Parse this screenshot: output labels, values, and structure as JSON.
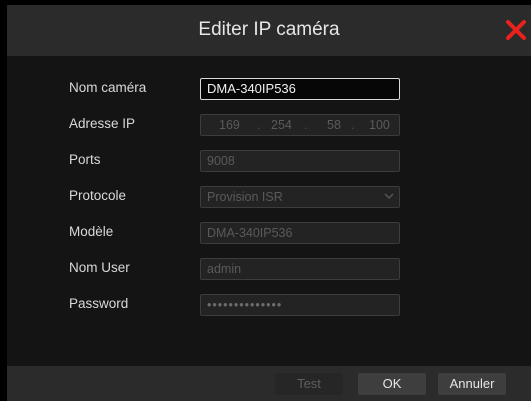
{
  "dialog": {
    "title": "Editer IP caméra",
    "close_icon": "close-icon",
    "accent_close": "#e8231c"
  },
  "form": {
    "camera_name": {
      "label": "Nom caméra",
      "value": "DMA-340IP536"
    },
    "ip_address": {
      "label": "Adresse IP",
      "octets": [
        "169",
        "254",
        "58",
        "100"
      ],
      "separator": "."
    },
    "ports": {
      "label": "Ports",
      "value": "9008"
    },
    "protocol": {
      "label": "Protocole",
      "value": "Provision ISR",
      "icon": "chevron-down-icon"
    },
    "model": {
      "label": "Modèle",
      "value": "DMA-340IP536"
    },
    "user": {
      "label": "Nom User",
      "value": "admin"
    },
    "password": {
      "label": "Password",
      "value": "••••••••••••••"
    }
  },
  "footer": {
    "test_label": "Test",
    "ok_label": "OK",
    "cancel_label": "Annuler"
  }
}
